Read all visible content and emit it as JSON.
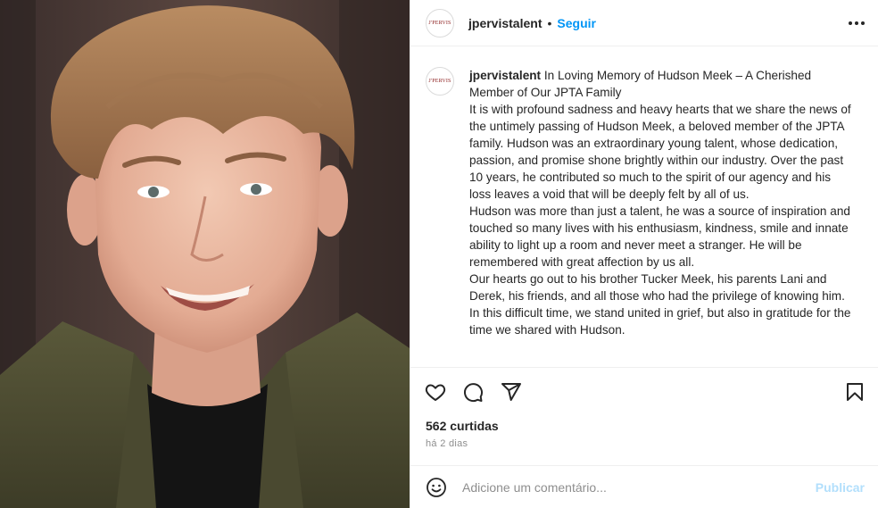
{
  "post": {
    "username": "jpervistalent",
    "follow_label": "Seguir",
    "separator": "•",
    "avatar_logo_text": "J'PERVIS",
    "caption": {
      "username": "jpervistalent",
      "lines": [
        "In Loving Memory of  Hudson Meek – A Cherished Member of Our JPTA Family",
        "It is with profound sadness and heavy hearts that we  share the news of the untimely passing of Hudson Meek, a beloved member of the JPTA family. Hudson was an extraordinary young talent, whose dedication, passion, and promise shone brightly within our industry. Over the past 10 years, he contributed so much to the spirit of our agency and his loss leaves a void that will be deeply felt by all of us.",
        "Hudson was more than just a talent, he was a source of inspiration and touched so many lives with  his enthusiasm, kindness, smile and innate ability to light up a room and never meet a stranger.  He will be remembered with great affection by us all.",
        "Our hearts go out to his brother Tucker Meek, his parents Lani and Derek, his friends, and all those who had the privilege of knowing  him. In this difficult time, we stand united in grief, but also in gratitude for the time we shared with  Hudson."
      ]
    },
    "likes": "562 curtidas",
    "time": "há 2 dias"
  },
  "comment": {
    "placeholder": "Adicione um comentário...",
    "post_label": "Publicar"
  },
  "icons": {
    "like": "heart-icon",
    "comment": "comment-icon",
    "share": "share-icon",
    "save": "bookmark-icon",
    "emoji": "emoji-icon",
    "more": "more-options-icon"
  },
  "colors": {
    "link_blue": "#0095f6",
    "publish_disabled": "#b2dffc",
    "text": "#262626",
    "muted": "#8e8e8e"
  }
}
